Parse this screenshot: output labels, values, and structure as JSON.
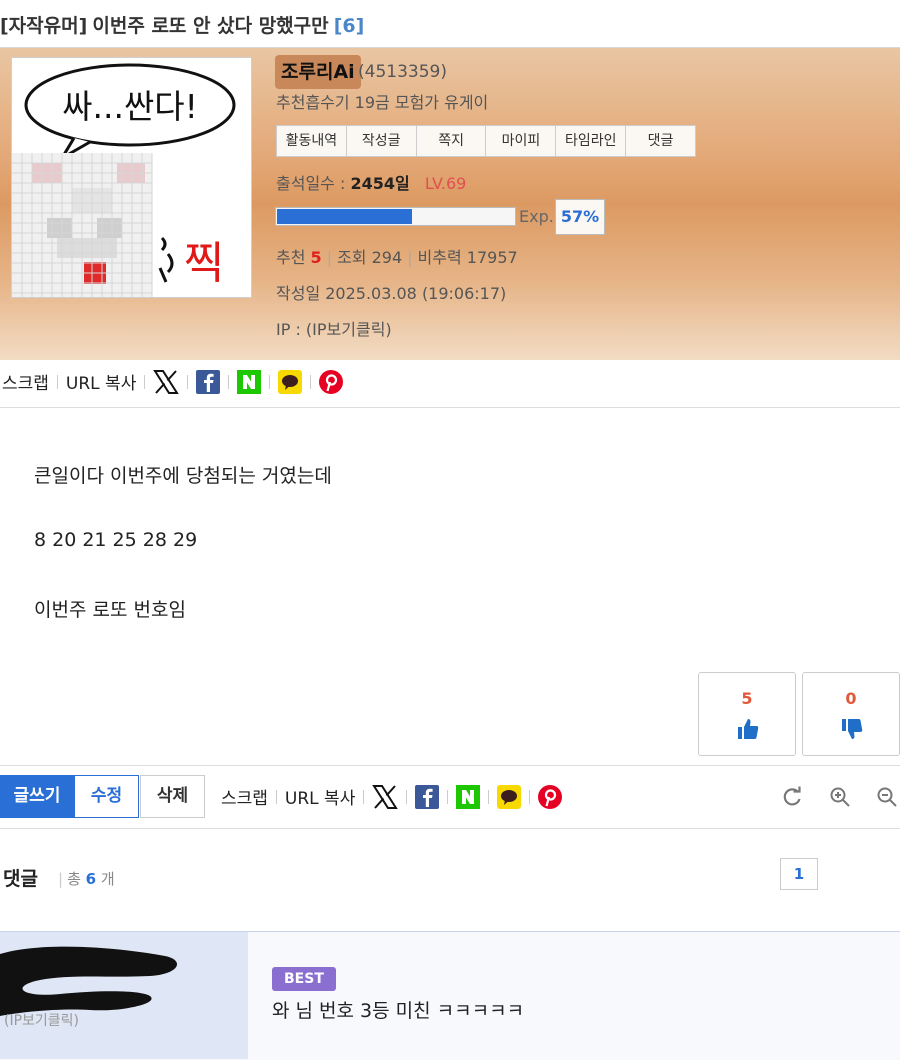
{
  "title": {
    "category": "[자작유머]",
    "text": "이번주 로또 안 샀다 망했구만",
    "comment_count": "[6]"
  },
  "author": {
    "avatar_caption_top": "싸...싼다!",
    "avatar_caption_side": "찍",
    "nickname": "조루리Ai",
    "user_id": "(4513359)",
    "rank": "추천흡수기 19금 모험가 유게이",
    "menu": [
      "활동내역",
      "작성글",
      "쪽지",
      "마이피",
      "타임라인",
      "댓글"
    ],
    "attendance_label": "출석일수 :",
    "attendance_value": "2454일",
    "level": "LV.69",
    "exp_label": "Exp.",
    "exp_pct": "57%",
    "exp_fraction": 0.57,
    "recommend_label": "추천",
    "recommend_value": "5",
    "views": "조회 294",
    "nonrecommend": "비추력 17957",
    "date": "작성일 2025.03.08 (19:06:17)",
    "ip": "IP : (IP보기클릭)"
  },
  "share": {
    "scrap": "스크랩",
    "url_copy": "URL 복사",
    "icons": [
      "x-icon",
      "facebook-icon",
      "naver-icon",
      "kakaotalk-icon",
      "pinterest-icon"
    ]
  },
  "body": {
    "lines": [
      "큰일이다 이번주에 당첨되는 거였는데",
      "8 20 21 25 28 29",
      "이번주 로또 번호임"
    ]
  },
  "votes": {
    "up": "5",
    "down": "0"
  },
  "actions": {
    "write": "글쓰기",
    "edit": "수정",
    "delete": "삭제"
  },
  "comments": {
    "title": "댓글",
    "total_prefix": "총",
    "total_value": "6",
    "total_suffix": "개",
    "page": "1",
    "items": [
      {
        "badge": "BEST",
        "text": "와 님 번호 3등 미친 ㅋㅋㅋㅋㅋ",
        "ip": "(IP보기클릭)"
      }
    ]
  },
  "colors": {
    "accent": "#2a6fd6",
    "level": "#e05050",
    "best_badge": "#8a6fd0",
    "profile_bg": "#dc9a62"
  }
}
